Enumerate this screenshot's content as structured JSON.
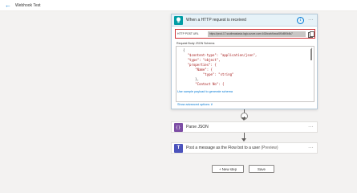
{
  "header": {
    "back_icon": "arrow-left-icon",
    "flow_name": "Webhook Test"
  },
  "trigger": {
    "title": "When a HTTP request is received",
    "info_icon": "info-icon",
    "more_icon": "ellipsis-icon",
    "url_label": "HTTP POST URL",
    "url_value": "https://prod-17.southeastasia.logic.azure.com:443/workflows/6f0d5f0b8c7",
    "copy_icon": "copy-icon",
    "schema_label": "Request Body JSON Schema",
    "schema_lines": [
      "{",
      "    \"$content-type\": \"application/json\",",
      "    \"type\": \"object\",",
      "    \"properties\": {",
      "        \"Name\": {",
      "            \"type\": \"string\"",
      "        },",
      "        \"Contact No\": {"
    ],
    "sample_link": "Use sample payload to generate schema",
    "advanced_link": "Show advanced options",
    "advanced_chevron": "∨"
  },
  "actions": [
    {
      "title": "Parse JSON",
      "icon": "parse-json-icon",
      "more_icon": "ellipsis-icon"
    },
    {
      "title": "Post a message as the Flow bot to a user",
      "preview": "(Preview)",
      "icon": "teams-icon",
      "more_icon": "ellipsis-icon"
    }
  ],
  "footer": {
    "new_step_label": "+ New step",
    "save_label": "Save"
  },
  "colors": {
    "accent": "#0078d4",
    "http_icon": "#009da5",
    "parse_icon": "#7d4ea5",
    "teams_icon": "#4b53bc",
    "url_highlight_border": "#d13438"
  }
}
